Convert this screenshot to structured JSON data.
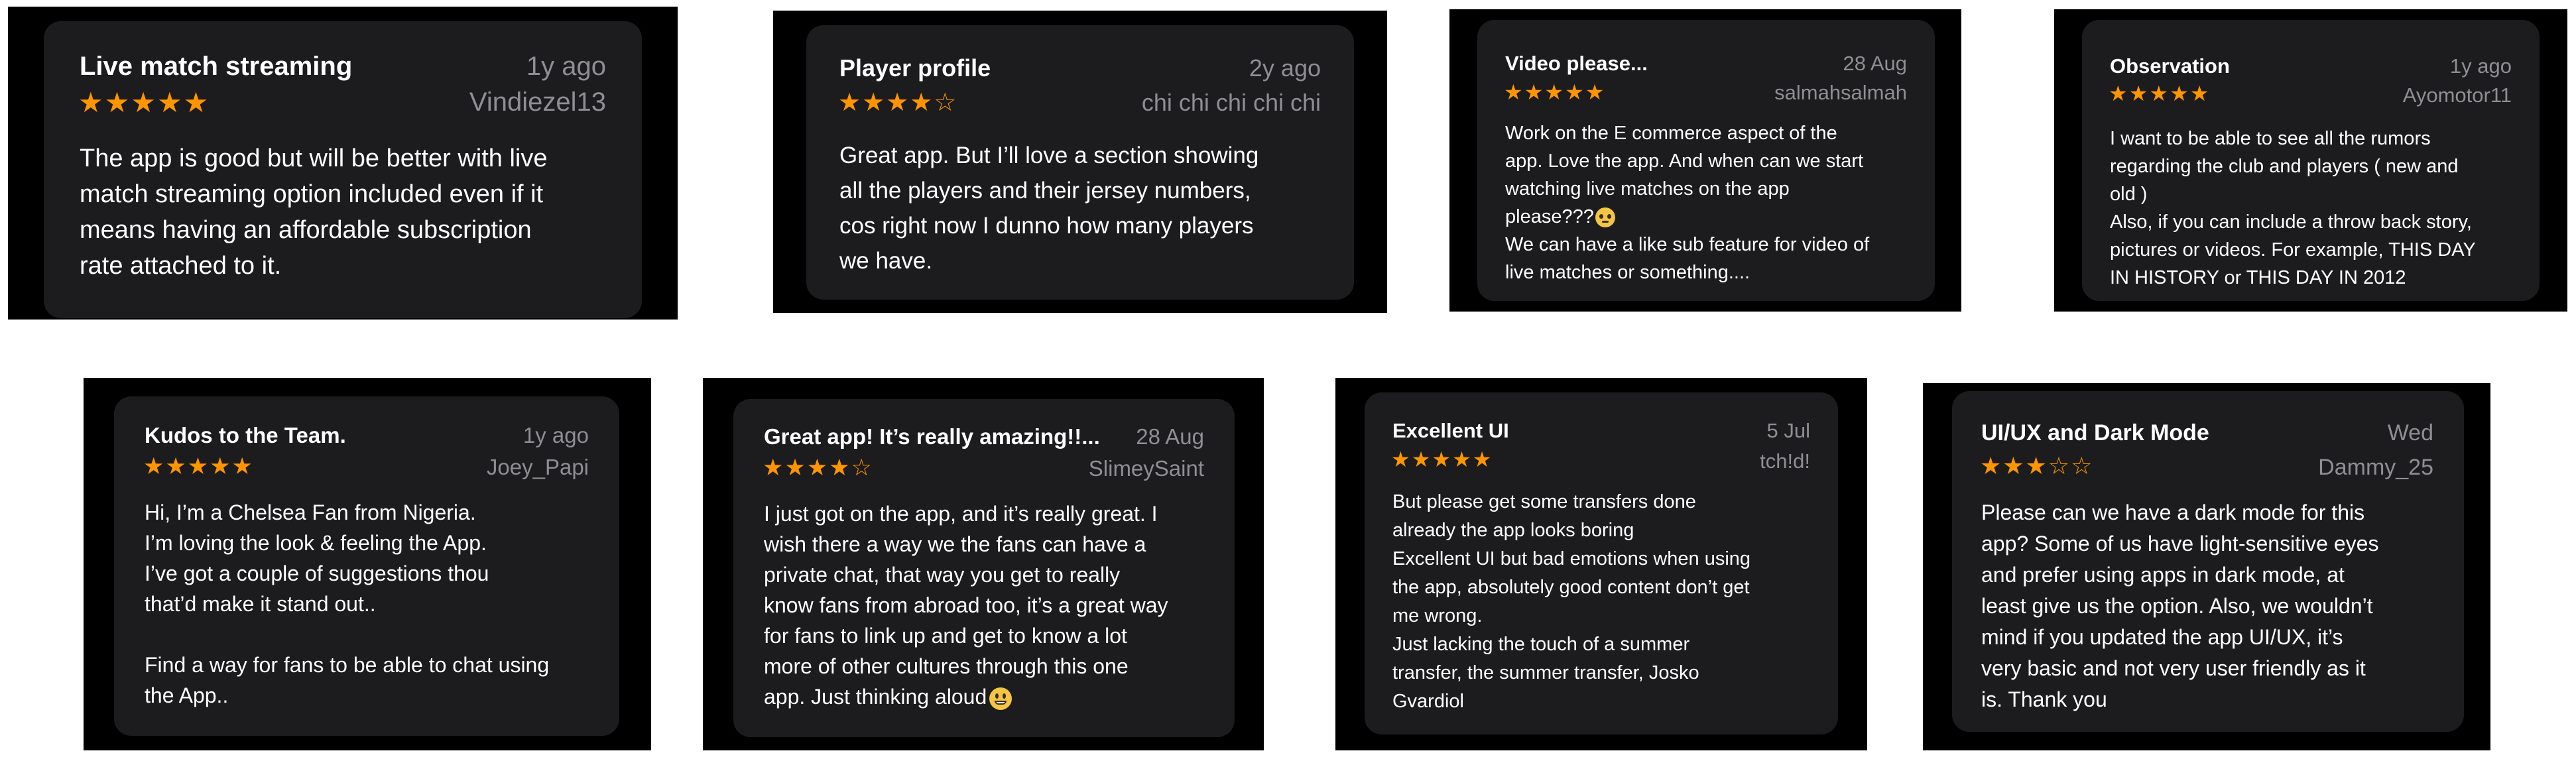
{
  "reviews": [
    {
      "title": "Live match streaming",
      "date": "1y ago",
      "stars": "★★★★★",
      "author": "Vindiezel13",
      "body": "The app is good but will be better with live\nmatch streaming option included even if it\nmeans having an affordable subscription\nrate attached to it."
    },
    {
      "title": "Player profile",
      "date": "2y ago",
      "stars": "★★★★☆",
      "author": "chi chi chi chi chi",
      "body": "Great app. But I’ll love a section showing\nall the players and their jersey numbers,\ncos right now I dunno how many players\nwe have."
    },
    {
      "title": "Video please...",
      "date": "28 Aug",
      "stars": "★★★★★",
      "author": "salmahsalmah",
      "body": "Work on the E commerce aspect of the\napp. Love the app. And when can we start\nwatching live matches on the app\nplease???",
      "body_end": "We can have a like sub feature for video of\nlive matches or something...."
    },
    {
      "title": "Observation",
      "date": "1y ago",
      "stars": "★★★★★",
      "author": "Ayomotor11",
      "body": "I want to be able to see all the rumors\nregarding the club and players ( new and\nold )\nAlso, if you can include a throw back story,\npictures or videos. For example, THIS DAY\nIN HISTORY or THIS DAY IN 2012"
    },
    {
      "title": "Kudos to the Team.",
      "date": "1y ago",
      "stars": "★★★★★",
      "author": "Joey_Papi",
      "body": "Hi, I’m a Chelsea Fan from Nigeria.\nI’m loving the look & feeling the App.\nI’ve got a couple of suggestions thou\nthat’d make it stand out..\n\nFind a way for fans to be able to chat using\nthe App.."
    },
    {
      "title": "Great app! It’s really amazing!!...",
      "date": "28 Aug",
      "stars": "★★★★☆",
      "author": "SlimeySaint",
      "body": "I just got on the app, and it’s really great. I\nwish there a way we the fans can have a\nprivate chat, that way you get to really\nknow fans from abroad too, it’s a great way\nfor fans to link up and get to know a lot\nmore of other cultures through this one\napp. Just thinking aloud"
    },
    {
      "title": "Excellent UI",
      "date": "5 Jul",
      "stars": "★★★★★",
      "author": "tch!d!",
      "body": "But please get some transfers done\nalready the app looks boring\nExcellent UI but bad emotions when using\nthe app, absolutely good content don’t get\nme wrong.\nJust lacking the touch of a summer\ntransfer, the summer transfer, Josko\nGvardiol"
    },
    {
      "title": "UI/UX and Dark Mode",
      "date": "Wed",
      "stars": "★★★☆☆",
      "author": "Dammy_25",
      "body": "Please can we have a dark mode for this\napp? Some of us have light-sensitive eyes\nand prefer using apps in dark mode, at\nleast give us the option. Also, we wouldn’t\nmind if you updated the app UI/UX, it’s\nvery basic and not very user friendly as it\nis. Thank you"
    }
  ],
  "colors": {
    "card": "#1c1c1e",
    "frame": "#000000",
    "star": "#ff9500",
    "muted": "#8e8e93"
  }
}
